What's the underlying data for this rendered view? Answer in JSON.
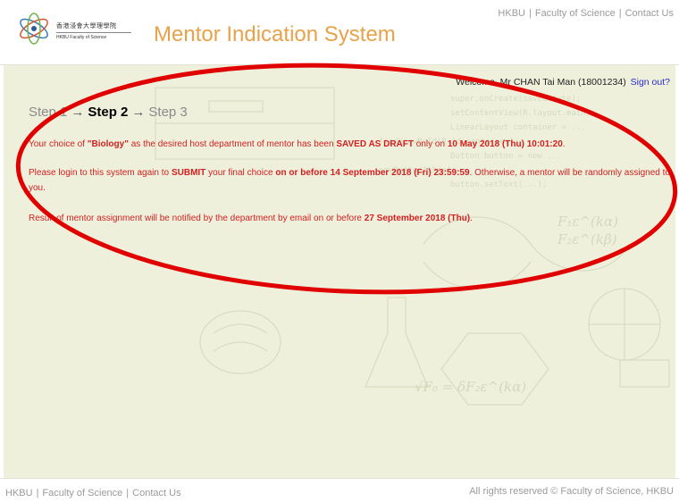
{
  "header": {
    "logo_chinese": "香港浸會大學理學院",
    "logo_english": "HKBU Faculty of Science",
    "app_title": "Mentor Indication System",
    "links": [
      "HKBU",
      "Faculty of Science",
      "Contact Us"
    ]
  },
  "user": {
    "welcome": "Welcome, Mr CHAN Tai Man (18001234)",
    "signout": "Sign out?"
  },
  "steps": {
    "step1": "Step 1",
    "step2": "Step 2",
    "step3": "Step 3",
    "arrow": "→"
  },
  "message1": {
    "t1": "Your choice of ",
    "department": "\"Biology\"",
    "t2": " as the desired host department of mentor has been ",
    "status": "SAVED AS DRAFT",
    "t3": " only on ",
    "saved_time": "10 May 2018 (Thu) 10:01:20",
    "t4": "."
  },
  "message2": {
    "t1": "Please login to this system again to ",
    "action": "SUBMIT",
    "t2": " your final choice ",
    "deadline": "on or before 14 September 2018 (Fri) 23:59:59",
    "t3": ". Otherwise, a mentor will be randomly assigned to you."
  },
  "message3": {
    "t1": "Result of mentor assignment will be notified by the department by email on or before ",
    "date": "27 September 2018 (Thu)",
    "t2": "."
  },
  "footer": {
    "links": [
      "HKBU",
      "Faculty of Science",
      "Contact Us"
    ],
    "copyright": "All rights reserved © Faculty of Science, HKBU"
  },
  "colors": {
    "accent_title": "#e8a24a",
    "message_red": "#d42020",
    "annotation_ellipse": "#e00000",
    "content_bg": "#eef0dc"
  }
}
